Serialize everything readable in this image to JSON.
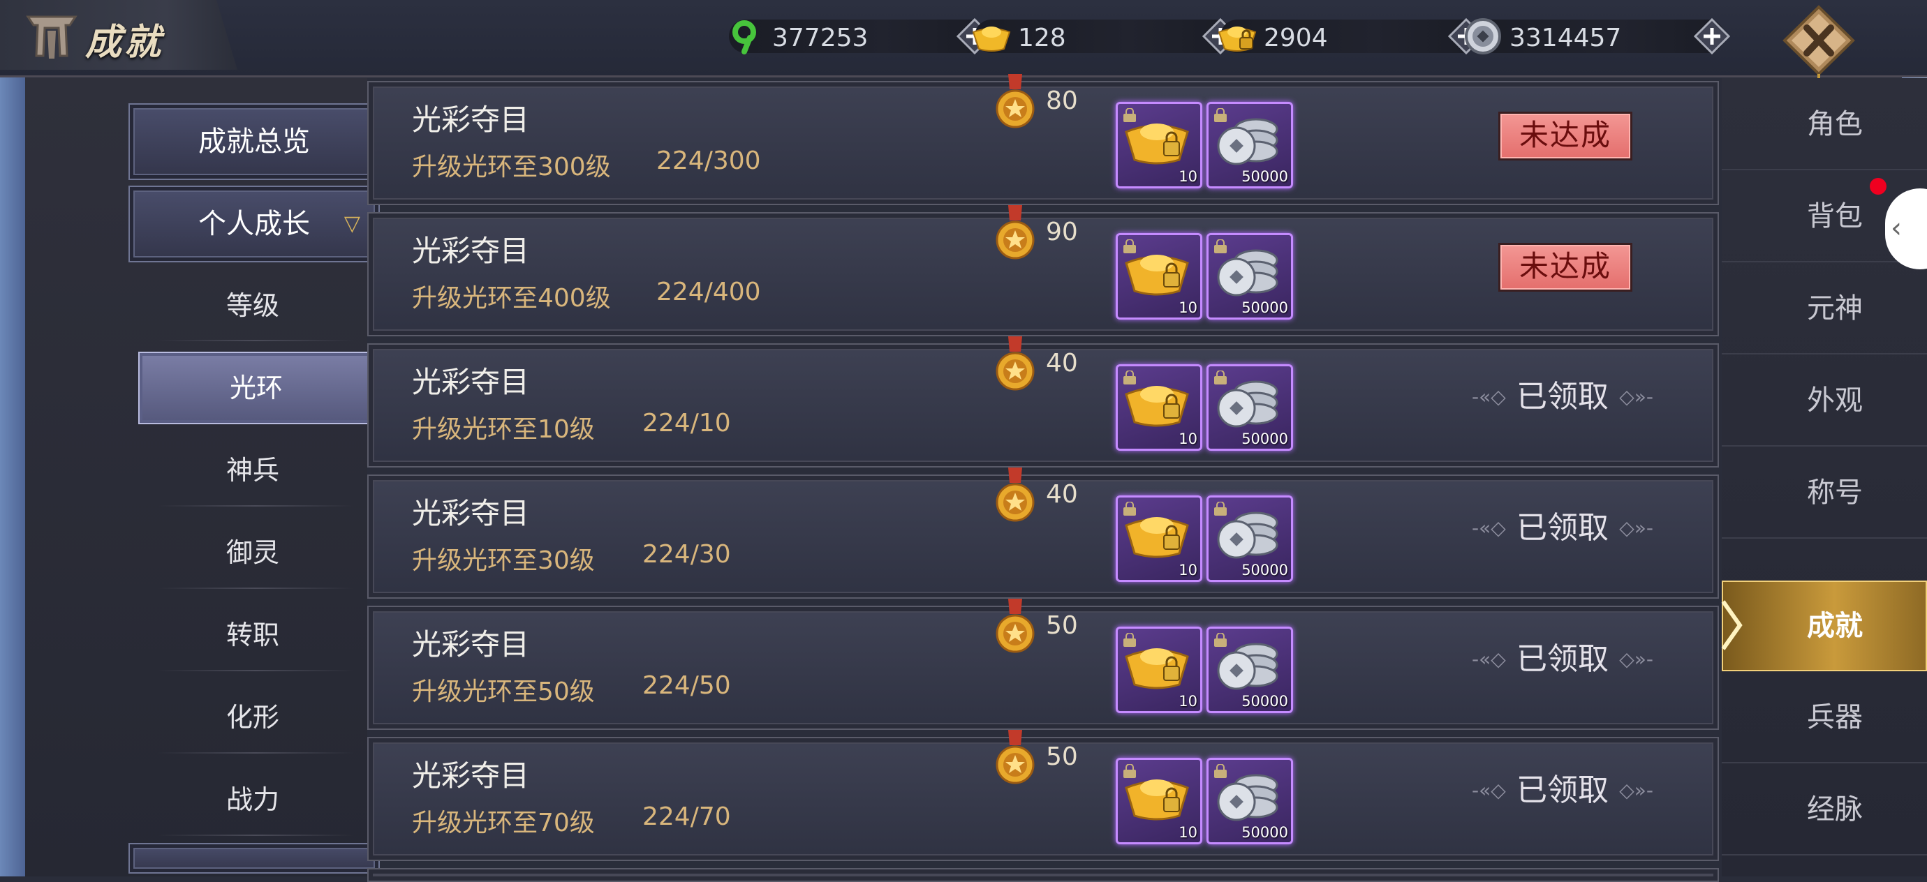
{
  "header": {
    "title": "成就"
  },
  "currencies": [
    {
      "icon": "jade-icon",
      "value": "377253"
    },
    {
      "icon": "gold-ingot-icon",
      "value": "128"
    },
    {
      "icon": "bound-gold-ingot-icon",
      "value": "2904"
    },
    {
      "icon": "silver-coin-icon",
      "value": "3314457"
    }
  ],
  "left_nav": {
    "overview": "成就总览",
    "group": "个人成长",
    "items": [
      "等级",
      "光环",
      "神兵",
      "御灵",
      "转职",
      "化形",
      "战力"
    ],
    "active_item": "光环"
  },
  "achievements": [
    {
      "title": "光彩夺目",
      "desc": "升级光环至300级",
      "progress": "224/300",
      "points": "80",
      "rewards": [
        "10",
        "50000"
      ],
      "status": "未达成",
      "done": false
    },
    {
      "title": "光彩夺目",
      "desc": "升级光环至400级",
      "progress": "224/400",
      "points": "90",
      "rewards": [
        "10",
        "50000"
      ],
      "status": "未达成",
      "done": false
    },
    {
      "title": "光彩夺目",
      "desc": "升级光环至10级",
      "progress": "224/10",
      "points": "40",
      "rewards": [
        "10",
        "50000"
      ],
      "status": "已领取",
      "done": true
    },
    {
      "title": "光彩夺目",
      "desc": "升级光环至30级",
      "progress": "224/30",
      "points": "40",
      "rewards": [
        "10",
        "50000"
      ],
      "status": "已领取",
      "done": true
    },
    {
      "title": "光彩夺目",
      "desc": "升级光环至50级",
      "progress": "224/50",
      "points": "50",
      "rewards": [
        "10",
        "50000"
      ],
      "status": "已领取",
      "done": true
    },
    {
      "title": "光彩夺目",
      "desc": "升级光环至70级",
      "progress": "224/70",
      "points": "50",
      "rewards": [
        "10",
        "50000"
      ],
      "status": "已领取",
      "done": true
    }
  ],
  "right_tabs": [
    "角色",
    "背包",
    "元神",
    "外观",
    "称号",
    "成就",
    "兵器",
    "经脉"
  ],
  "active_tab": "成就",
  "colors": {
    "accent_gold": "#c99a3b",
    "status_red": "#e46e6c",
    "reward_purple": "#c58bff"
  }
}
